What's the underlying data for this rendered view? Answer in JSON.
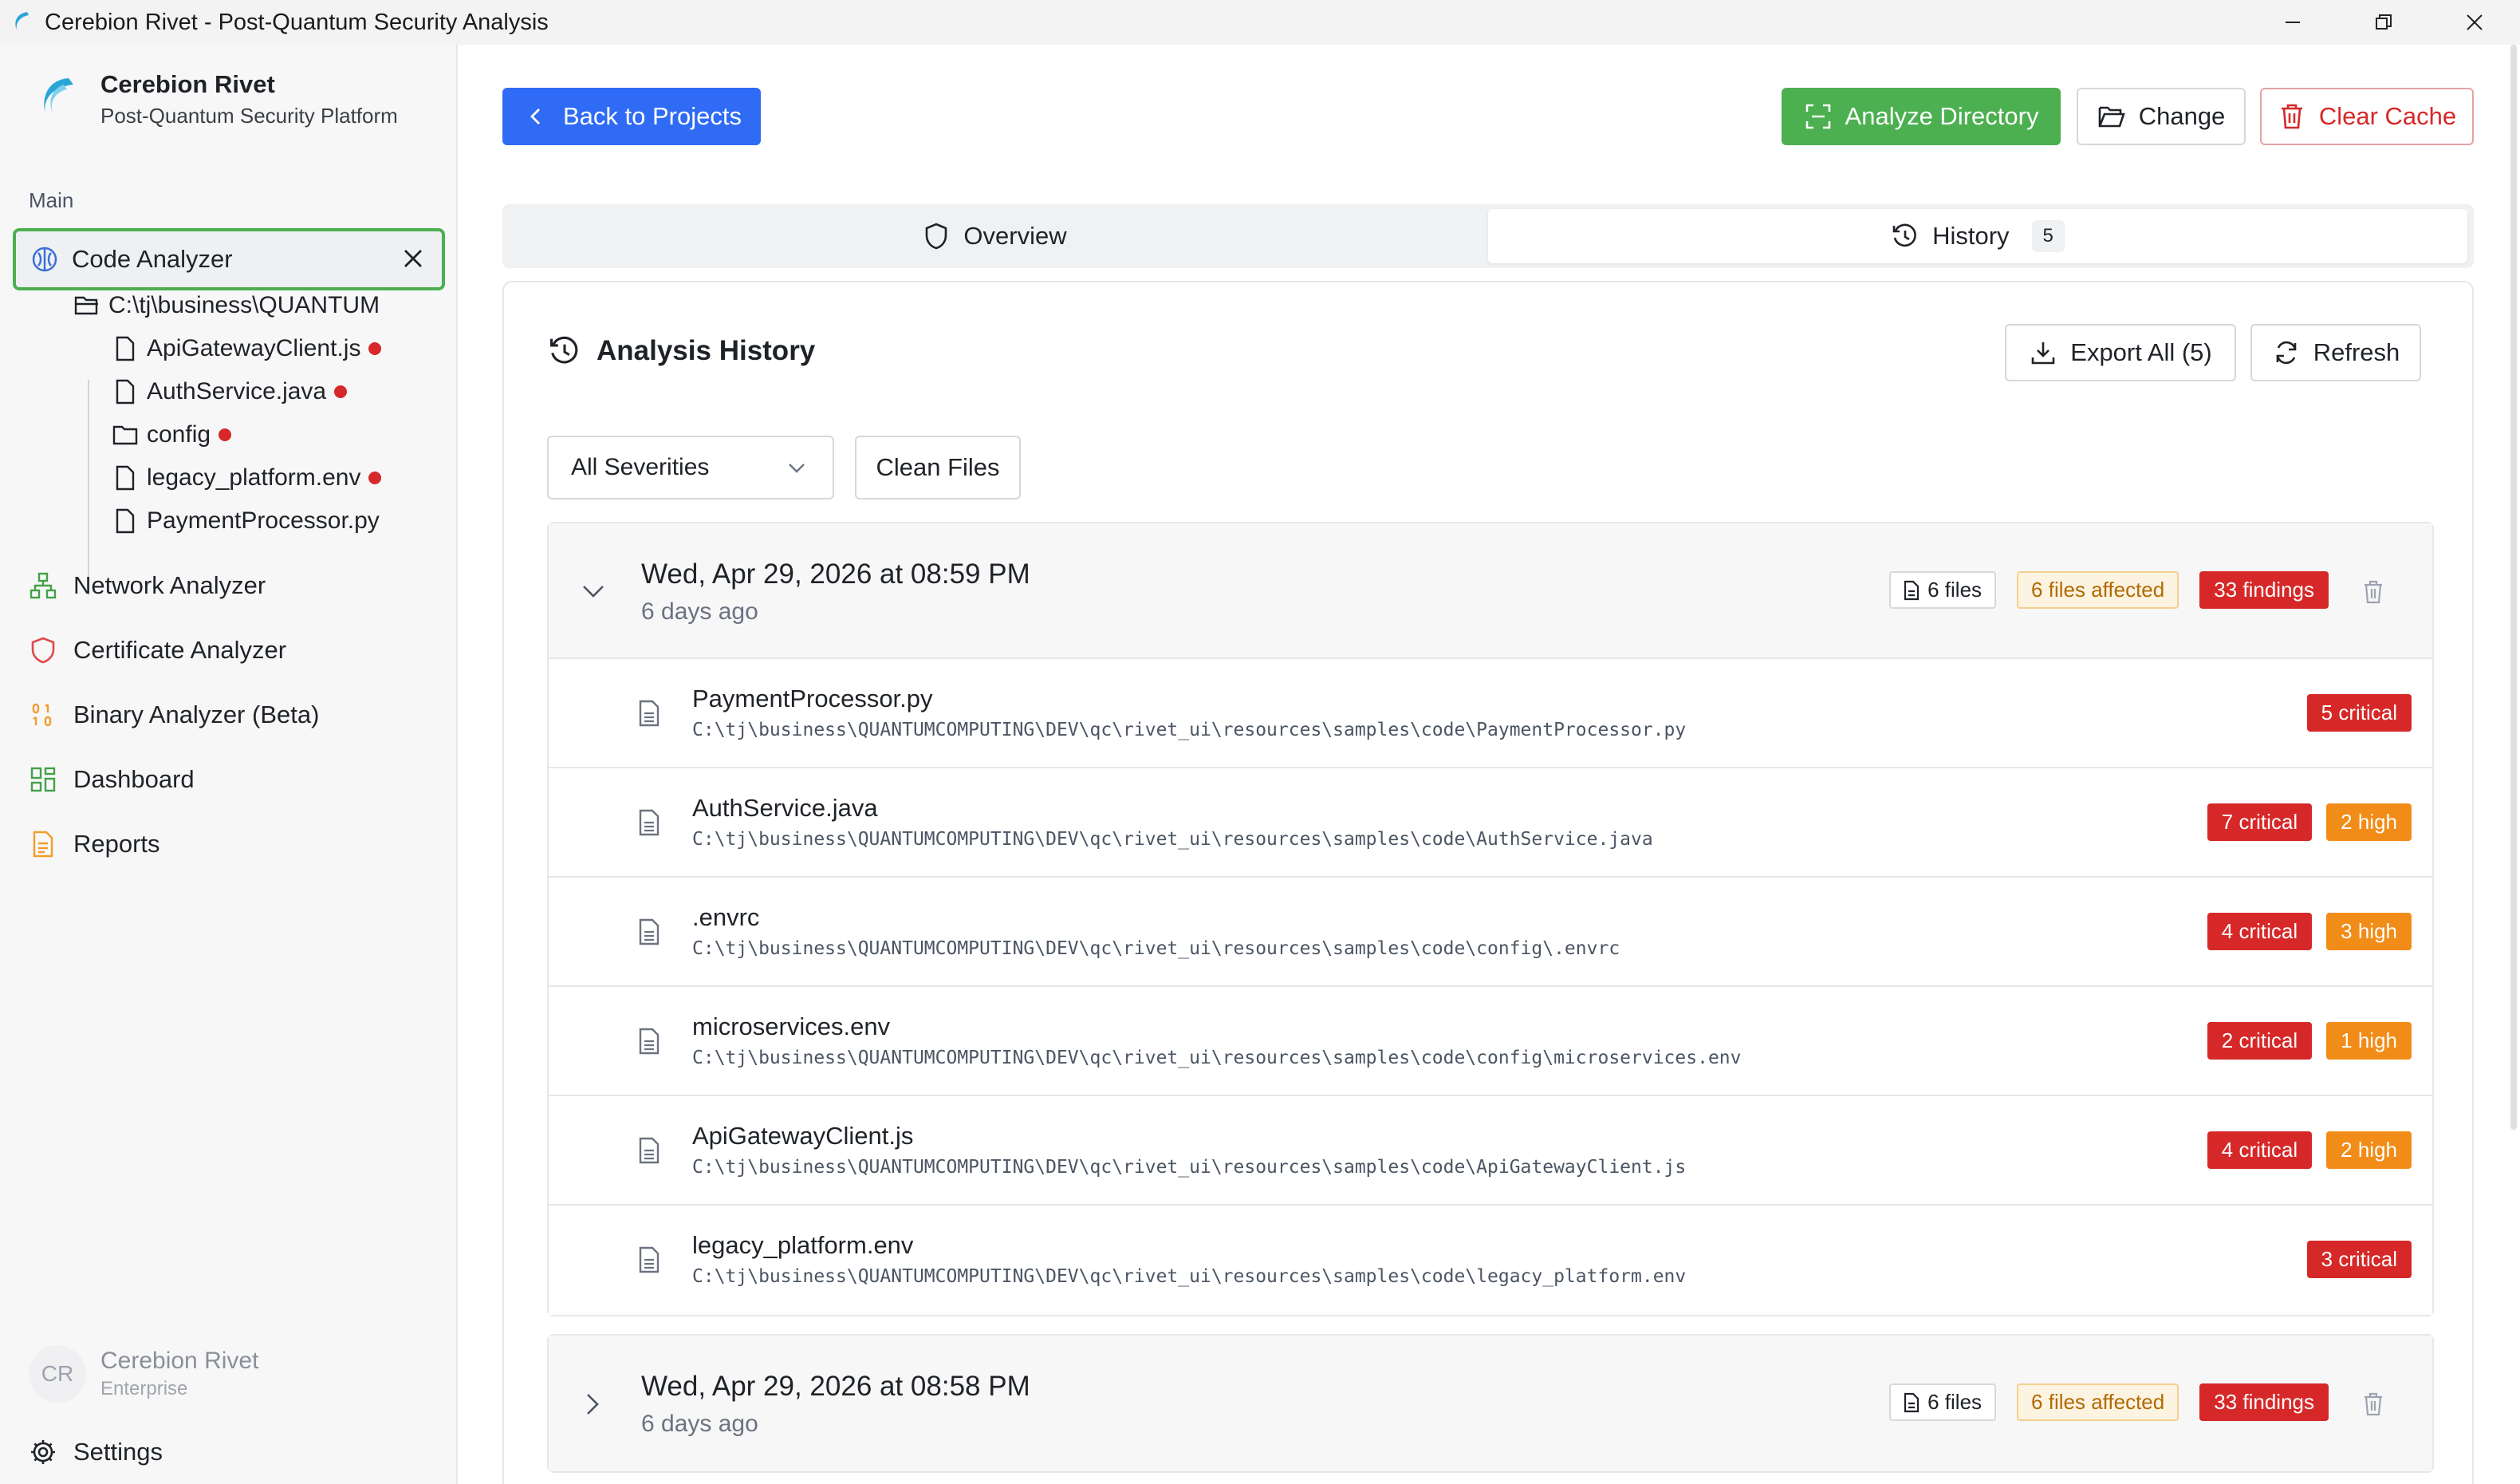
{
  "window": {
    "title": "Cerebion Rivet - Post-Quantum Security Analysis"
  },
  "sidebar": {
    "brand_name": "Cerebion Rivet",
    "brand_subtitle": "Post-Quantum Security Platform",
    "section_label": "Main",
    "active_item": "Code Analyzer",
    "tree": {
      "root": "C:\\tj\\business\\QUANTUM",
      "items": [
        {
          "label": "ApiGatewayClient.js",
          "type": "file",
          "flagged": true
        },
        {
          "label": "AuthService.java",
          "type": "file",
          "flagged": true
        },
        {
          "label": "config",
          "type": "folder",
          "flagged": true
        },
        {
          "label": "legacy_platform.env",
          "type": "file",
          "flagged": true
        },
        {
          "label": "PaymentProcessor.py",
          "type": "file",
          "flagged": false
        }
      ]
    },
    "nav": [
      {
        "label": "Network Analyzer",
        "icon": "network-icon"
      },
      {
        "label": "Certificate Analyzer",
        "icon": "shield-icon"
      },
      {
        "label": "Binary Analyzer (Beta)",
        "icon": "binary-icon"
      },
      {
        "label": "Dashboard",
        "icon": "dashboard-icon"
      },
      {
        "label": "Reports",
        "icon": "report-icon"
      }
    ],
    "user": {
      "initials": "CR",
      "name": "Cerebion Rivet",
      "plan": "Enterprise"
    },
    "settings_label": "Settings"
  },
  "toolbar": {
    "back_label": "Back to Projects",
    "analyze_label": "Analyze Directory",
    "change_label": "Change",
    "clear_cache_label": "Clear Cache"
  },
  "tabs": [
    {
      "label": "Overview",
      "active": false
    },
    {
      "label": "History",
      "active": true,
      "count": "5"
    }
  ],
  "history": {
    "title": "Analysis History",
    "export_label": "Export All (5)",
    "refresh_label": "Refresh",
    "filter_value": "All Severities",
    "clean_files_label": "Clean Files",
    "groups": [
      {
        "date": "Wed, Apr 29, 2026 at 08:59 PM",
        "ago": "6 days ago",
        "files": "6 files",
        "affected": "6 files affected",
        "findings": "33 findings",
        "expanded": true,
        "rows": [
          {
            "name": "PaymentProcessor.py",
            "path": "C:\\tj\\business\\QUANTUMCOMPUTING\\DEV\\qc\\rivet_ui\\resources\\samples\\code\\PaymentProcessor.py",
            "critical": "5 critical",
            "high": ""
          },
          {
            "name": "AuthService.java",
            "path": "C:\\tj\\business\\QUANTUMCOMPUTING\\DEV\\qc\\rivet_ui\\resources\\samples\\code\\AuthService.java",
            "critical": "7 critical",
            "high": "2 high"
          },
          {
            "name": ".envrc",
            "path": "C:\\tj\\business\\QUANTUMCOMPUTING\\DEV\\qc\\rivet_ui\\resources\\samples\\code\\config\\.envrc",
            "critical": "4 critical",
            "high": "3 high"
          },
          {
            "name": "microservices.env",
            "path": "C:\\tj\\business\\QUANTUMCOMPUTING\\DEV\\qc\\rivet_ui\\resources\\samples\\code\\config\\microservices.env",
            "critical": "2 critical",
            "high": "1 high"
          },
          {
            "name": "ApiGatewayClient.js",
            "path": "C:\\tj\\business\\QUANTUMCOMPUTING\\DEV\\qc\\rivet_ui\\resources\\samples\\code\\ApiGatewayClient.js",
            "critical": "4 critical",
            "high": "2 high"
          },
          {
            "name": "legacy_platform.env",
            "path": "C:\\tj\\business\\QUANTUMCOMPUTING\\DEV\\qc\\rivet_ui\\resources\\samples\\code\\legacy_platform.env",
            "critical": "3 critical",
            "high": ""
          }
        ]
      },
      {
        "date": "Wed, Apr 29, 2026 at 08:58 PM",
        "ago": "6 days ago",
        "files": "6 files",
        "affected": "6 files affected",
        "findings": "33 findings",
        "expanded": false,
        "rows": []
      }
    ]
  },
  "colors": {
    "primary": "#2f6bf5",
    "success": "#4caf50",
    "critical": "#d62828",
    "high": "#f28c18",
    "affected_bg": "#fdf3e1"
  }
}
